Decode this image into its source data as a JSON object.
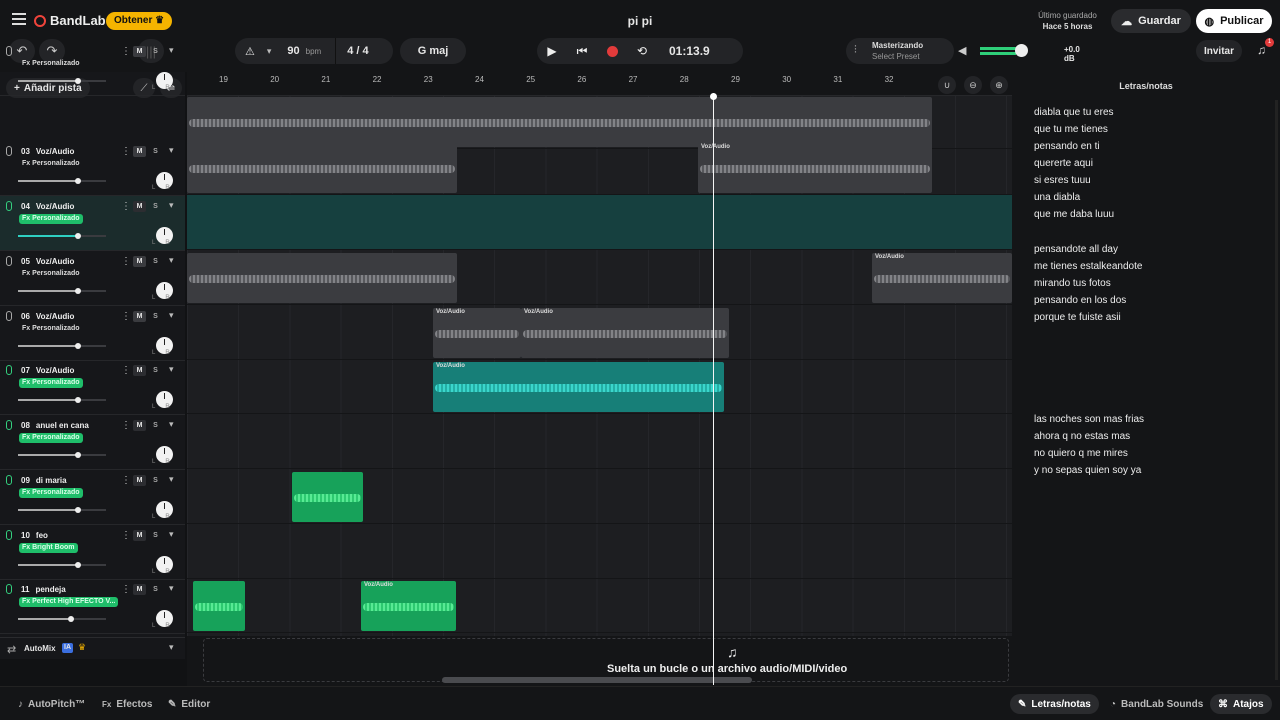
{
  "app": {
    "brand": "BandLab",
    "get_label": "Obtener",
    "project_title": "pi pi"
  },
  "header": {
    "last_saved_label": "Último guardado",
    "last_saved_time": "Hace 5 horas",
    "save_label": "Guardar",
    "publish_label": "Publicar"
  },
  "toolbar": {
    "bpm": "90",
    "bpm_unit": "bpm",
    "time_signature": "4 / 4",
    "key": "G maj",
    "time": "01:13.9",
    "mastering_label": "Masterizando",
    "preset_label": "Select Preset",
    "volume_db": "+0.0 dB",
    "invite_label": "Invitar",
    "notifications": "1"
  },
  "track_panel": {
    "add_track_label": "Añadir pista",
    "automix_label": "AutoMix",
    "ai_badge": "IA"
  },
  "ruler": {
    "ticks": [
      "19",
      "20",
      "21",
      "22",
      "23",
      "24",
      "25",
      "26",
      "27",
      "28",
      "29",
      "30",
      "31",
      "32"
    ]
  },
  "tracks": [
    {
      "num": "",
      "name": "",
      "fx": "Fx Personalizado",
      "fx_green": false,
      "volume": 0.68
    },
    {
      "num": "03",
      "name": "Voz/Audio",
      "fx": "Fx Personalizado",
      "fx_green": false,
      "volume": 0.68
    },
    {
      "num": "04",
      "name": "Voz/Audio",
      "fx": "Fx Personalizado",
      "fx_green": true,
      "volume": 0.68
    },
    {
      "num": "05",
      "name": "Voz/Audio",
      "fx": "Fx Personalizado",
      "fx_green": false,
      "volume": 0.68
    },
    {
      "num": "06",
      "name": "Voz/Audio",
      "fx": "Fx Personalizado",
      "fx_green": false,
      "volume": 0.68
    },
    {
      "num": "07",
      "name": "Voz/Audio",
      "fx": "Fx Personalizado",
      "fx_green": true,
      "volume": 0.68
    },
    {
      "num": "08",
      "name": "anuel en cana",
      "fx": "Fx Personalizado",
      "fx_green": true,
      "volume": 0.68
    },
    {
      "num": "09",
      "name": "di maria",
      "fx": "Fx Personalizado",
      "fx_green": true,
      "volume": 0.68
    },
    {
      "num": "10",
      "name": "feo",
      "fx": "Fx Bright Boom",
      "fx_green": true,
      "volume": 0.68
    },
    {
      "num": "11",
      "name": "pendeja",
      "fx": "Fx Perfect High EFECTO V...",
      "fx_green": true,
      "volume": 0.6
    }
  ],
  "clip_label": "Voz/Audio",
  "drop_zone": {
    "text": "Suelta un bucle o un archivo audio/MIDI/video"
  },
  "lyrics": {
    "title": "Letras/notas",
    "block1": [
      "diabla que tu eres",
      "que tu me tienes",
      "pensando en ti",
      "quererte aqui",
      "si esres tuuu",
      "una diabla",
      "que me daba luuu"
    ],
    "block2": [
      "pensandote all day",
      "me tienes estalkeandote",
      "mirando tus fotos",
      "pensando en los dos",
      "porque te fuiste asii"
    ],
    "block3": [
      "las noches son mas frias",
      "ahora q no estas mas",
      "no quiero q me mires",
      "y no sepas quien soy ya"
    ]
  },
  "bottom_bar": {
    "autopitch": "AutoPitch™",
    "effects": "Efectos",
    "editor": "Editor",
    "lyrics": "Letras/notas",
    "sounds": "BandLab Sounds",
    "shortcuts": "Atajos"
  },
  "colors": {
    "accent_teal": "#2fd0c2",
    "accent_green": "#1fbe6a",
    "brand_red": "#f0443b",
    "get_yellow": "#f5b400"
  }
}
